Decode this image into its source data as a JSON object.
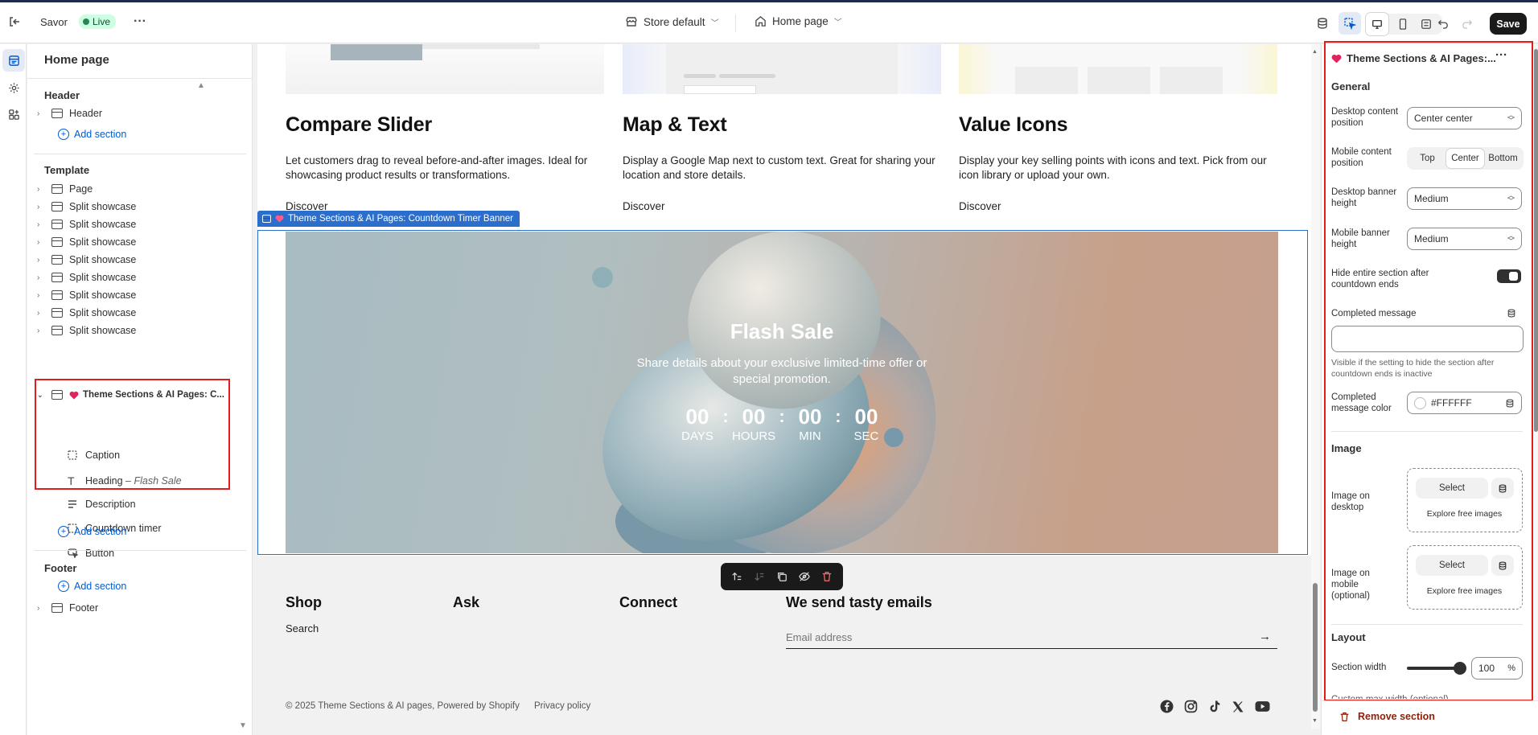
{
  "topbar": {
    "store_name": "Savor",
    "live_badge": "Live",
    "theme_dropdown": "Store default",
    "page_dropdown": "Home page",
    "save_label": "Save"
  },
  "left_panel": {
    "title": "Home page",
    "header_group": "Header",
    "header_item": "Header",
    "add_section": "Add section",
    "template_group": "Template",
    "template_items": [
      "Page",
      "Split showcase",
      "Split showcase",
      "Split showcase",
      "Split showcase",
      "Split showcase",
      "Split showcase",
      "Split showcase",
      "Split showcase"
    ],
    "selected_section": "Theme Sections & AI Pages: C...",
    "blocks": {
      "caption": "Caption",
      "heading": "Heading",
      "heading_sep": " – ",
      "heading_value": "Flash Sale",
      "description": "Description",
      "countdown": "Countdown timer",
      "button": "Button"
    },
    "footer_group": "Footer",
    "footer_item": "Footer"
  },
  "preview": {
    "cards": [
      {
        "title": "Compare Slider",
        "text": "Let customers drag to reveal before-and-after images. Ideal for showcasing product results or transformations.",
        "link": "Discover"
      },
      {
        "title": "Map & Text",
        "text": "Display a Google Map next to custom text. Great for sharing your location and store details.",
        "link": "Discover"
      },
      {
        "title": "Value Icons",
        "text": "Display your key selling points with icons and text. Pick from our icon library or upload your own.",
        "link": "Discover"
      }
    ],
    "section_tag": "Theme Sections & AI Pages: Countdown Timer Banner",
    "banner": {
      "heading": "Flash Sale",
      "description": "Share details about your exclusive limited-time offer or special promotion.",
      "timer": [
        {
          "value": "00",
          "label": "DAYS"
        },
        {
          "value": "00",
          "label": "HOURS"
        },
        {
          "value": "00",
          "label": "MIN"
        },
        {
          "value": "00",
          "label": "SEC"
        }
      ],
      "separator": ":"
    },
    "footer": {
      "shop_title": "Shop",
      "shop_link": "Search",
      "ask_title": "Ask",
      "connect_title": "Connect",
      "newsletter_title": "We send tasty emails",
      "email_placeholder": "Email address",
      "copyright": "© 2025 Theme Sections & AI pages, Powered by Shopify",
      "privacy": "Privacy policy"
    }
  },
  "right_panel": {
    "title": "Theme Sections & AI Pages:...",
    "general": "General",
    "desktop_pos_label": "Desktop content position",
    "desktop_pos_value": "Center center",
    "mobile_pos_label": "Mobile content position",
    "mobile_pos_options": [
      "Top",
      "Center",
      "Bottom"
    ],
    "desktop_height_label": "Desktop banner height",
    "desktop_height_value": "Medium",
    "mobile_height_label": "Mobile banner height",
    "mobile_height_value": "Medium",
    "hide_label": "Hide entire section after countdown ends",
    "completed_msg_label": "Completed message",
    "completed_msg_hint": "Visible if the setting to hide the section after countdown ends is inactive",
    "completed_color_label": "Completed message color",
    "completed_color_value": "#FFFFFF",
    "image_head": "Image",
    "image_desktop_label": "Image on desktop",
    "image_mobile_label": "Image on mobile (optional)",
    "select_label": "Select",
    "explore_label": "Explore free images",
    "layout_head": "Layout",
    "width_label": "Section width",
    "width_value": "100",
    "width_unit": "%",
    "cut_label": "Custom max width (optional)",
    "remove_label": "Remove section"
  },
  "colors": {
    "accent": "#005bd3",
    "highlight": "#e11d1d",
    "selected_tag": "#2c6ecb",
    "danger": "#8e1f0b"
  }
}
